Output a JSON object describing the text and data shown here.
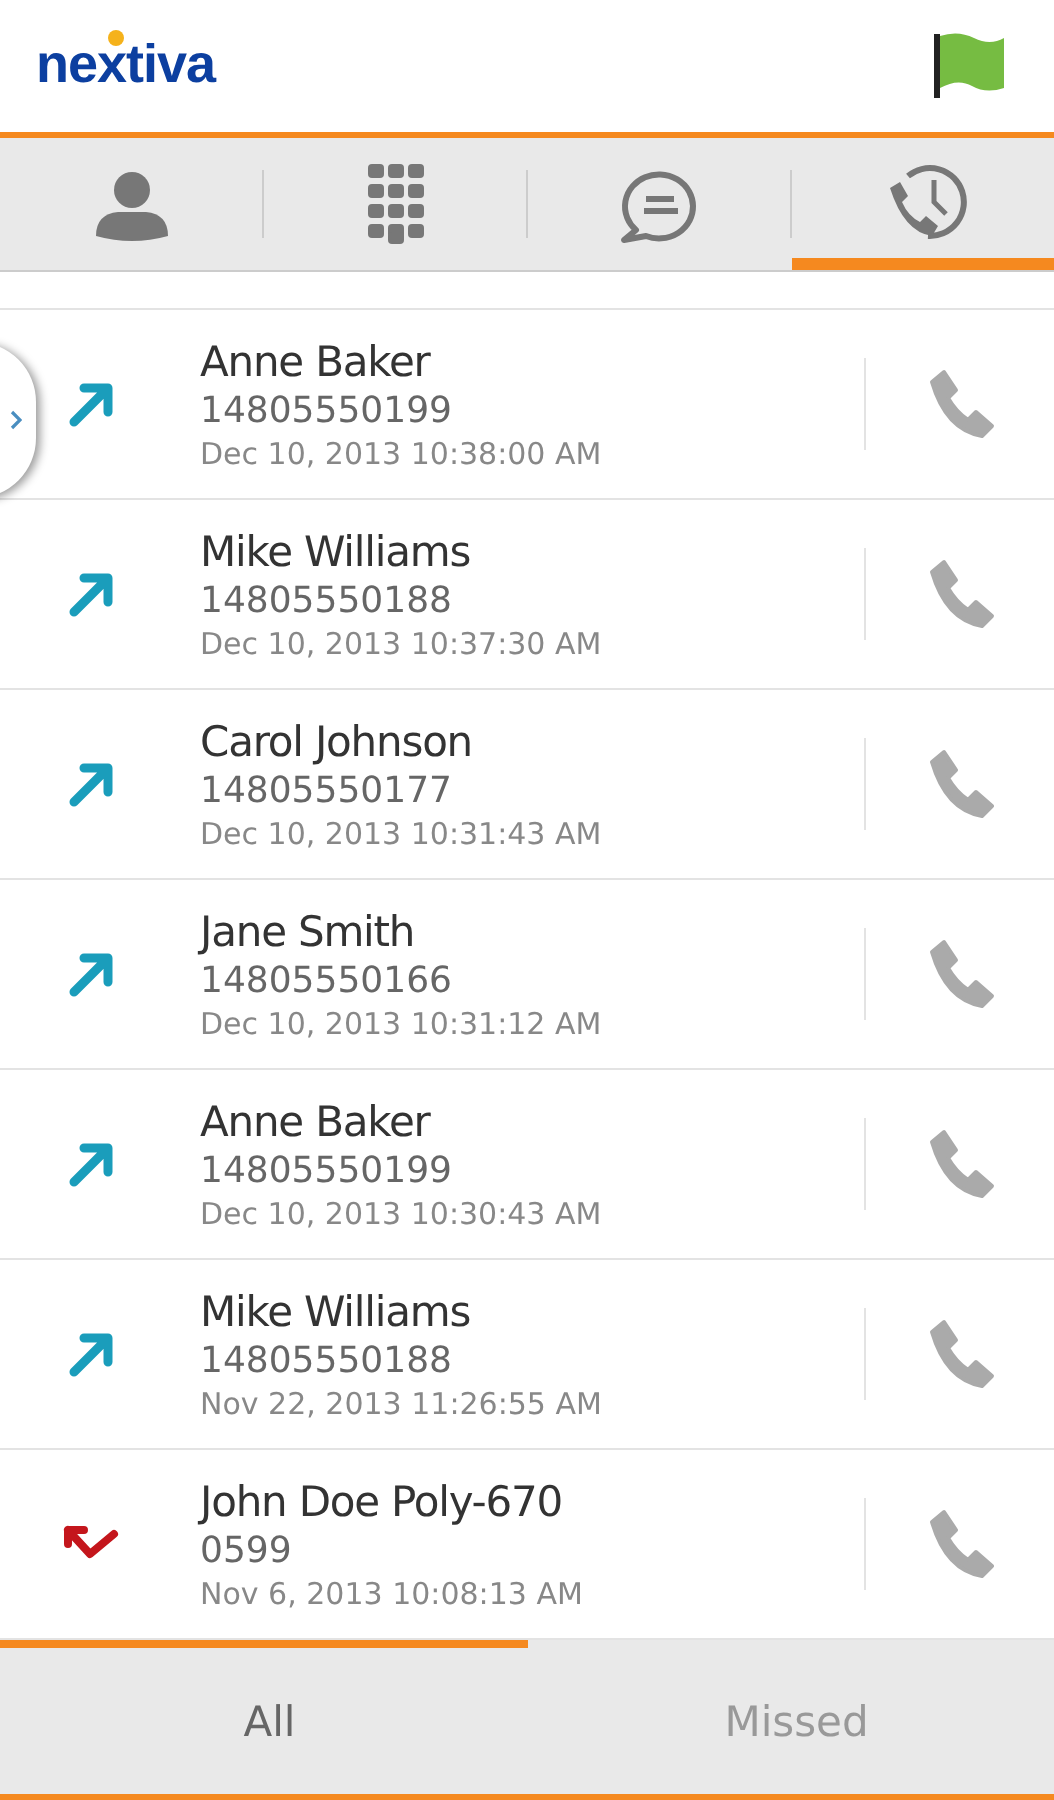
{
  "header": {
    "logo": "nextiva"
  },
  "tabs": [
    {
      "kind": "contacts",
      "selected": false
    },
    {
      "kind": "dialpad",
      "selected": false
    },
    {
      "kind": "chat",
      "selected": false
    },
    {
      "kind": "history",
      "selected": true
    }
  ],
  "calls": [
    {
      "kind": "outgoing",
      "name": "Anne Baker",
      "number": "14805550199",
      "time": "Dec 10, 2013 10:38:00 AM"
    },
    {
      "kind": "outgoing",
      "name": "Mike Williams",
      "number": "14805550188",
      "time": "Dec 10, 2013 10:37:30 AM"
    },
    {
      "kind": "outgoing",
      "name": "Carol Johnson",
      "number": "14805550177",
      "time": "Dec 10, 2013 10:31:43 AM"
    },
    {
      "kind": "outgoing",
      "name": "Jane Smith",
      "number": "14805550166",
      "time": "Dec 10, 2013 10:31:12 AM"
    },
    {
      "kind": "outgoing",
      "name": "Anne Baker",
      "number": "14805550199",
      "time": "Dec 10, 2013 10:30:43 AM"
    },
    {
      "kind": "outgoing",
      "name": "Mike Williams",
      "number": "14805550188",
      "time": "Nov 22, 2013 11:26:55 AM"
    },
    {
      "kind": "missed",
      "name": "John Doe Poly-670",
      "number": "0599",
      "time": "Nov 6, 2013 10:08:13 AM"
    }
  ],
  "filters": [
    {
      "label": "All",
      "selected": true
    },
    {
      "label": "Missed",
      "selected": false
    }
  ]
}
